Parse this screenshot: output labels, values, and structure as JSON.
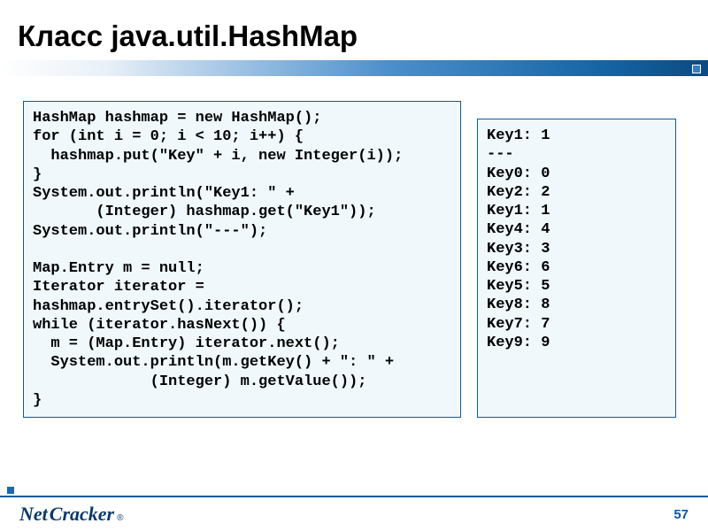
{
  "title": "Класс java.util.HashMap",
  "code_left": "HashMap hashmap = new HashMap();\nfor (int i = 0; i < 10; i++) {\n  hashmap.put(\"Key\" + i, new Integer(i));\n}\nSystem.out.println(\"Key1: \" +\n       (Integer) hashmap.get(\"Key1\"));\nSystem.out.println(\"---\");\n\nMap.Entry m = null;\nIterator iterator =\nhashmap.entrySet().iterator();\nwhile (iterator.hasNext()) {\n  m = (Map.Entry) iterator.next();\n  System.out.println(m.getKey() + \": \" +\n             (Integer) m.getValue());\n}",
  "code_right": "Key1: 1\n---\nKey0: 0\nKey2: 2\nKey1: 1\nKey4: 4\nKey3: 3\nKey6: 6\nKey5: 5\nKey8: 8\nKey7: 7\nKey9: 9",
  "logo_net": "Net",
  "logo_cracker": "Cracker",
  "logo_reg": "®",
  "page_number": "57"
}
